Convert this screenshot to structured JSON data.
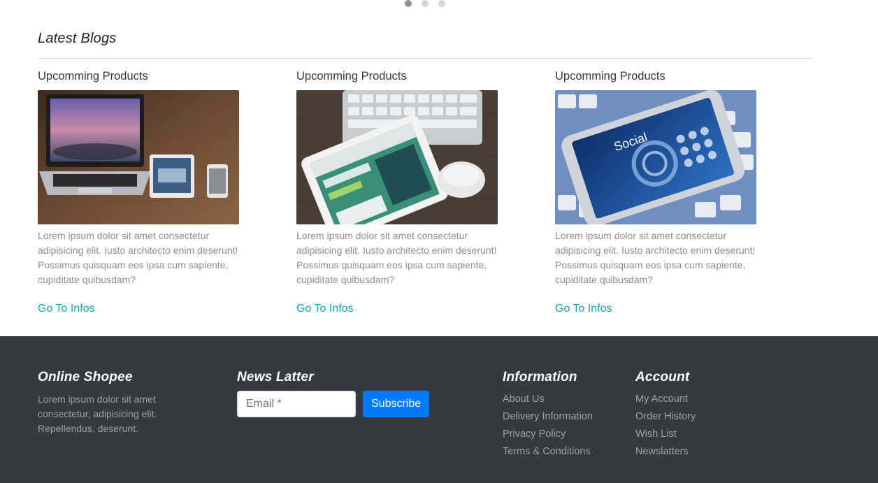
{
  "carousel": {
    "dot_count": 3,
    "active_index": 0
  },
  "blogs": {
    "section_title": "Latest Blogs",
    "cards": [
      {
        "title": "Upcomming Products",
        "image": "laptop-tablet-phone-photo",
        "text": "Lorem ipsum dolor sit amet consectetur adipisicing elit. Iusto architecto enim deserunt! Possimus quisquam eos ipsa cum sapiente, cupiditate quibusdam?",
        "link": "Go To Infos"
      },
      {
        "title": "Upcomming Products",
        "image": "tablet-keyboard-mouse-photo",
        "text": "Lorem ipsum dolor sit amet consectetur adipisicing elit. Iusto architecto enim deserunt! Possimus quisquam eos ipsa cum sapiente, cupiditate quibusdam?",
        "link": "Go To Infos"
      },
      {
        "title": "Upcomming Products",
        "image": "smartphone-social-keyboard-photo",
        "text": "Lorem ipsum dolor sit amet consectetur adipisicing elit. Iusto architecto enim deserunt! Possimus quisquam eos ipsa cum sapiente, cupiditate quibusdam?",
        "link": "Go To Infos",
        "phone_label": "Social"
      }
    ]
  },
  "footer": {
    "shop": {
      "heading": "Online Shopee",
      "text": "Lorem ipsum dolor sit amet consectetur, adipisicing elit. Repellendus, deserunt."
    },
    "newsletter": {
      "heading": "News Latter",
      "email_placeholder": "Email *",
      "subscribe_label": "Subscribe"
    },
    "information": {
      "heading": "Information",
      "links": [
        "About Us",
        "Delivery Information",
        "Privacy Policy",
        "Terms & Conditions"
      ]
    },
    "account": {
      "heading": "Account",
      "links": [
        "My Account",
        "Order History",
        "Wish List",
        "Newslatters"
      ]
    }
  },
  "colors": {
    "footer_bg": "#343a40",
    "link": "#17a2b8",
    "button": "#007bff"
  }
}
